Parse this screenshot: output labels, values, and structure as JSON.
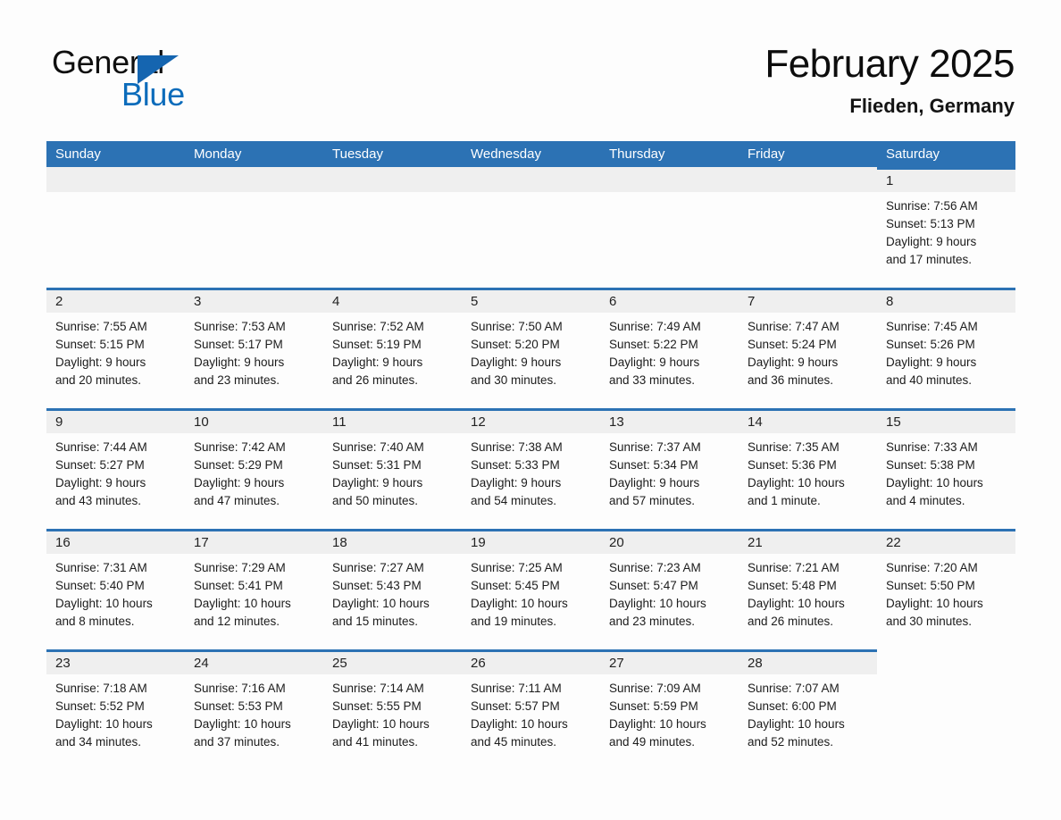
{
  "brand": {
    "name_part1": "General",
    "name_part2": "Blue",
    "accent_color": "#0c6cbb",
    "triangle_color": "#1565b0"
  },
  "header": {
    "month_title": "February 2025",
    "location": "Flieden, Germany"
  },
  "theme": {
    "header_blue": "#2c72b4",
    "daynum_band": "#efefef",
    "page_background": "#fdfdfd"
  },
  "weekdays": [
    "Sunday",
    "Monday",
    "Tuesday",
    "Wednesday",
    "Thursday",
    "Friday",
    "Saturday"
  ],
  "weeks": [
    [
      {
        "day": "",
        "empty": true
      },
      {
        "day": "",
        "empty": true
      },
      {
        "day": "",
        "empty": true
      },
      {
        "day": "",
        "empty": true
      },
      {
        "day": "",
        "empty": true
      },
      {
        "day": "",
        "empty": true
      },
      {
        "day": "1",
        "sunrise": "Sunrise: 7:56 AM",
        "sunset": "Sunset: 5:13 PM",
        "daylight_l1": "Daylight: 9 hours",
        "daylight_l2": "and 17 minutes."
      }
    ],
    [
      {
        "day": "2",
        "sunrise": "Sunrise: 7:55 AM",
        "sunset": "Sunset: 5:15 PM",
        "daylight_l1": "Daylight: 9 hours",
        "daylight_l2": "and 20 minutes."
      },
      {
        "day": "3",
        "sunrise": "Sunrise: 7:53 AM",
        "sunset": "Sunset: 5:17 PM",
        "daylight_l1": "Daylight: 9 hours",
        "daylight_l2": "and 23 minutes."
      },
      {
        "day": "4",
        "sunrise": "Sunrise: 7:52 AM",
        "sunset": "Sunset: 5:19 PM",
        "daylight_l1": "Daylight: 9 hours",
        "daylight_l2": "and 26 minutes."
      },
      {
        "day": "5",
        "sunrise": "Sunrise: 7:50 AM",
        "sunset": "Sunset: 5:20 PM",
        "daylight_l1": "Daylight: 9 hours",
        "daylight_l2": "and 30 minutes."
      },
      {
        "day": "6",
        "sunrise": "Sunrise: 7:49 AM",
        "sunset": "Sunset: 5:22 PM",
        "daylight_l1": "Daylight: 9 hours",
        "daylight_l2": "and 33 minutes."
      },
      {
        "day": "7",
        "sunrise": "Sunrise: 7:47 AM",
        "sunset": "Sunset: 5:24 PM",
        "daylight_l1": "Daylight: 9 hours",
        "daylight_l2": "and 36 minutes."
      },
      {
        "day": "8",
        "sunrise": "Sunrise: 7:45 AM",
        "sunset": "Sunset: 5:26 PM",
        "daylight_l1": "Daylight: 9 hours",
        "daylight_l2": "and 40 minutes."
      }
    ],
    [
      {
        "day": "9",
        "sunrise": "Sunrise: 7:44 AM",
        "sunset": "Sunset: 5:27 PM",
        "daylight_l1": "Daylight: 9 hours",
        "daylight_l2": "and 43 minutes."
      },
      {
        "day": "10",
        "sunrise": "Sunrise: 7:42 AM",
        "sunset": "Sunset: 5:29 PM",
        "daylight_l1": "Daylight: 9 hours",
        "daylight_l2": "and 47 minutes."
      },
      {
        "day": "11",
        "sunrise": "Sunrise: 7:40 AM",
        "sunset": "Sunset: 5:31 PM",
        "daylight_l1": "Daylight: 9 hours",
        "daylight_l2": "and 50 minutes."
      },
      {
        "day": "12",
        "sunrise": "Sunrise: 7:38 AM",
        "sunset": "Sunset: 5:33 PM",
        "daylight_l1": "Daylight: 9 hours",
        "daylight_l2": "and 54 minutes."
      },
      {
        "day": "13",
        "sunrise": "Sunrise: 7:37 AM",
        "sunset": "Sunset: 5:34 PM",
        "daylight_l1": "Daylight: 9 hours",
        "daylight_l2": "and 57 minutes."
      },
      {
        "day": "14",
        "sunrise": "Sunrise: 7:35 AM",
        "sunset": "Sunset: 5:36 PM",
        "daylight_l1": "Daylight: 10 hours",
        "daylight_l2": "and 1 minute."
      },
      {
        "day": "15",
        "sunrise": "Sunrise: 7:33 AM",
        "sunset": "Sunset: 5:38 PM",
        "daylight_l1": "Daylight: 10 hours",
        "daylight_l2": "and 4 minutes."
      }
    ],
    [
      {
        "day": "16",
        "sunrise": "Sunrise: 7:31 AM",
        "sunset": "Sunset: 5:40 PM",
        "daylight_l1": "Daylight: 10 hours",
        "daylight_l2": "and 8 minutes."
      },
      {
        "day": "17",
        "sunrise": "Sunrise: 7:29 AM",
        "sunset": "Sunset: 5:41 PM",
        "daylight_l1": "Daylight: 10 hours",
        "daylight_l2": "and 12 minutes."
      },
      {
        "day": "18",
        "sunrise": "Sunrise: 7:27 AM",
        "sunset": "Sunset: 5:43 PM",
        "daylight_l1": "Daylight: 10 hours",
        "daylight_l2": "and 15 minutes."
      },
      {
        "day": "19",
        "sunrise": "Sunrise: 7:25 AM",
        "sunset": "Sunset: 5:45 PM",
        "daylight_l1": "Daylight: 10 hours",
        "daylight_l2": "and 19 minutes."
      },
      {
        "day": "20",
        "sunrise": "Sunrise: 7:23 AM",
        "sunset": "Sunset: 5:47 PM",
        "daylight_l1": "Daylight: 10 hours",
        "daylight_l2": "and 23 minutes."
      },
      {
        "day": "21",
        "sunrise": "Sunrise: 7:21 AM",
        "sunset": "Sunset: 5:48 PM",
        "daylight_l1": "Daylight: 10 hours",
        "daylight_l2": "and 26 minutes."
      },
      {
        "day": "22",
        "sunrise": "Sunrise: 7:20 AM",
        "sunset": "Sunset: 5:50 PM",
        "daylight_l1": "Daylight: 10 hours",
        "daylight_l2": "and 30 minutes."
      }
    ],
    [
      {
        "day": "23",
        "sunrise": "Sunrise: 7:18 AM",
        "sunset": "Sunset: 5:52 PM",
        "daylight_l1": "Daylight: 10 hours",
        "daylight_l2": "and 34 minutes."
      },
      {
        "day": "24",
        "sunrise": "Sunrise: 7:16 AM",
        "sunset": "Sunset: 5:53 PM",
        "daylight_l1": "Daylight: 10 hours",
        "daylight_l2": "and 37 minutes."
      },
      {
        "day": "25",
        "sunrise": "Sunrise: 7:14 AM",
        "sunset": "Sunset: 5:55 PM",
        "daylight_l1": "Daylight: 10 hours",
        "daylight_l2": "and 41 minutes."
      },
      {
        "day": "26",
        "sunrise": "Sunrise: 7:11 AM",
        "sunset": "Sunset: 5:57 PM",
        "daylight_l1": "Daylight: 10 hours",
        "daylight_l2": "and 45 minutes."
      },
      {
        "day": "27",
        "sunrise": "Sunrise: 7:09 AM",
        "sunset": "Sunset: 5:59 PM",
        "daylight_l1": "Daylight: 10 hours",
        "daylight_l2": "and 49 minutes."
      },
      {
        "day": "28",
        "sunrise": "Sunrise: 7:07 AM",
        "sunset": "Sunset: 6:00 PM",
        "daylight_l1": "Daylight: 10 hours",
        "daylight_l2": "and 52 minutes."
      },
      {
        "day": "",
        "empty": true
      }
    ]
  ]
}
